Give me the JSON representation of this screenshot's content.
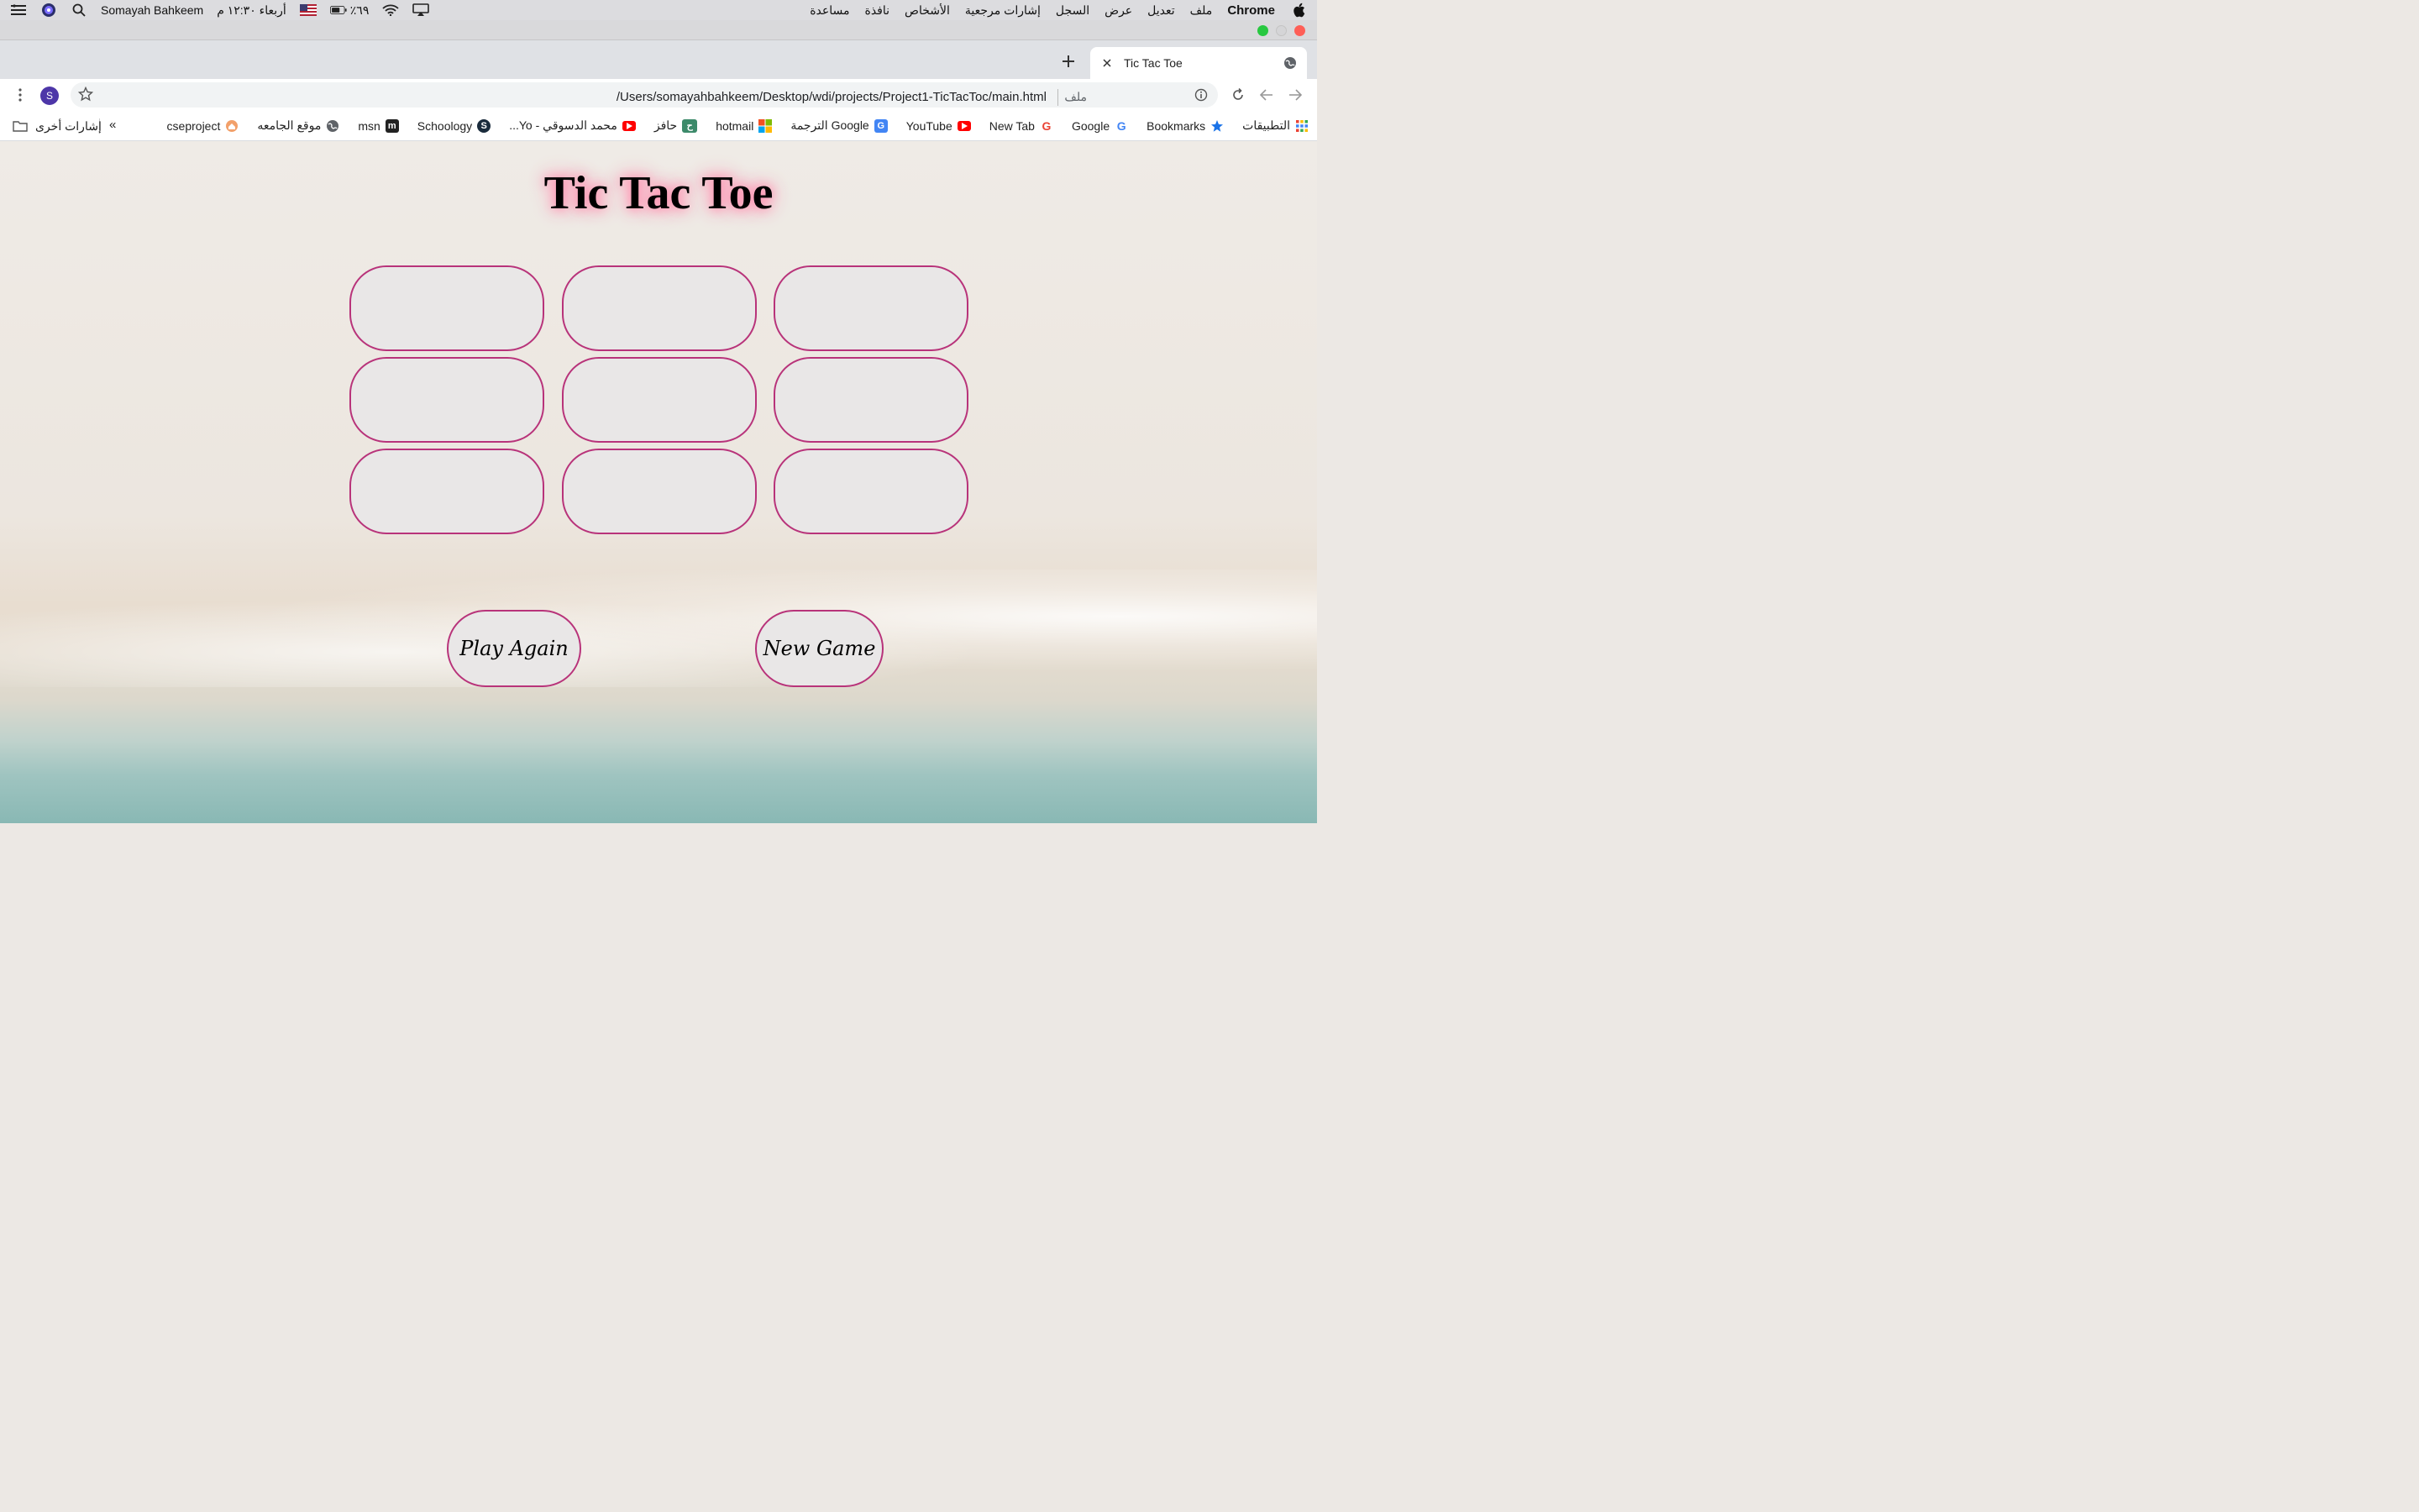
{
  "menubar": {
    "app_name": "Chrome",
    "menus": [
      "ملف",
      "تعديل",
      "عرض",
      "السجل",
      "إشارات مرجعية",
      "الأشخاص",
      "نافذة",
      "مساعدة"
    ],
    "battery": "٦٩٪",
    "clock": "أربعاء ١٢:٣٠ م",
    "user": "Somayah Bahkeem"
  },
  "tab": {
    "title": "Tic Tac Toe"
  },
  "toolbar": {
    "url": "/Users/somayahbahkeem/Desktop/wdi/projects/Project1-TicTacToc/main.html",
    "scheme_label": "ملف",
    "profile_initial": "S"
  },
  "bookmarks": {
    "items": [
      {
        "label": "التطبيقات",
        "icon": "apps-grid-icon"
      },
      {
        "label": "Bookmarks",
        "icon": "star-icon"
      },
      {
        "label": "Google",
        "icon": "google-icon"
      },
      {
        "label": "New Tab",
        "icon": "google-icon"
      },
      {
        "label": "YouTube",
        "icon": "youtube-icon"
      },
      {
        "label": "Google الترجمة",
        "icon": "translate-icon"
      },
      {
        "label": "hotmail",
        "icon": "microsoft-icon"
      },
      {
        "label": "حافز",
        "icon": "hafiz-icon"
      },
      {
        "label": "محمد الدسوقي - Yo...",
        "icon": "youtube-icon"
      },
      {
        "label": "Schoology",
        "icon": "schoology-icon"
      },
      {
        "label": "msn",
        "icon": "msn-icon"
      },
      {
        "label": "موقع الجامعه",
        "icon": "globe-icon"
      },
      {
        "label": "cseproject",
        "icon": "home-icon"
      }
    ],
    "more": "»",
    "other_label": "إشارات أخرى"
  },
  "game": {
    "title": "Tic Tac Toe",
    "cells": [
      "",
      "",
      "",
      "",
      "",
      "",
      "",
      "",
      ""
    ],
    "play_again_label": "Play Again",
    "new_game_label": "New Game",
    "accent_color": "#b8337a"
  }
}
